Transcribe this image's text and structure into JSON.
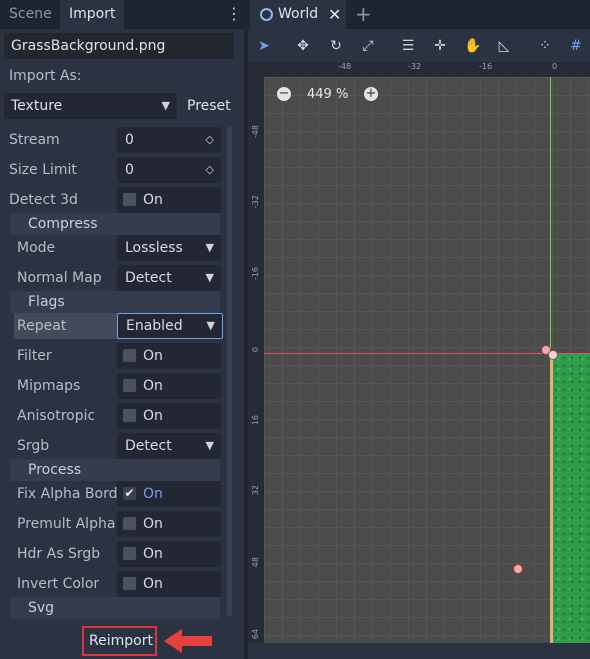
{
  "dock": {
    "tabs": [
      "Scene",
      "Import"
    ],
    "file_name": "GrassBackground.png",
    "import_as_label": "Import As:",
    "import_as_value": "Texture",
    "preset_label": "Preset",
    "props": [
      {
        "label": "Stream",
        "value": "0"
      },
      {
        "label": "Size Limit",
        "value": "0"
      },
      {
        "label": "Detect 3d",
        "check": "On"
      }
    ],
    "sections": [
      "Compress",
      "Flags",
      "Process",
      "Svg"
    ],
    "compress": [
      {
        "label": "Mode",
        "value": "Lossless"
      },
      {
        "label": "Normal Map",
        "value": "Detect"
      }
    ],
    "flags": [
      {
        "label": "Repeat",
        "value": "Enabled"
      },
      {
        "label": "Filter",
        "check": "On"
      },
      {
        "label": "Mipmaps",
        "check": "On"
      },
      {
        "label": "Anisotropic",
        "check": "On"
      },
      {
        "label": "Srgb",
        "value": "Detect"
      }
    ],
    "process": [
      {
        "label": "Fix Alpha Bord",
        "check": "On"
      },
      {
        "label": "Premult Alpha",
        "check": "On"
      },
      {
        "label": "Hdr As Srgb",
        "check": "On"
      },
      {
        "label": "Invert Color",
        "check": "On"
      }
    ],
    "reimport_label": "Reimport"
  },
  "viewport": {
    "tab": "World",
    "zoom": "449 %",
    "ruler_h": [
      "-48",
      "-32",
      "-16",
      "0"
    ],
    "ruler_v": [
      "-48",
      "-32",
      "-16",
      "0",
      "16",
      "32",
      "48",
      "64"
    ]
  },
  "colors": {
    "accent": "#6fa2ee",
    "highlight": "#d9363e",
    "grass": "#2f9e4c"
  }
}
